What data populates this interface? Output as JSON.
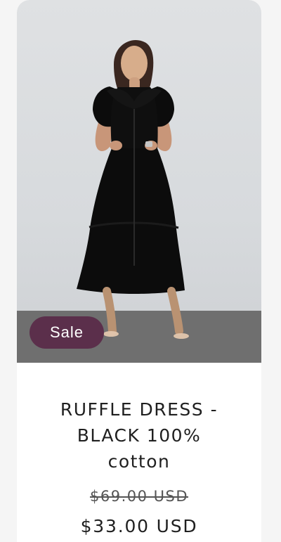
{
  "product": {
    "badge": "Sale",
    "title_line_1": "RUFFLE DRESS -",
    "title_line_2": "BLACK 100%",
    "title_line_3": "cotton",
    "compare_price": "$69.00 USD",
    "sale_price": "$33.00 USD"
  },
  "colors": {
    "badge_bg": "#5b2f4b",
    "text": "#1f1f1f",
    "dress": "#0c0c0c",
    "wall": "#dfe1e3",
    "floor": "#6f6f6f"
  }
}
